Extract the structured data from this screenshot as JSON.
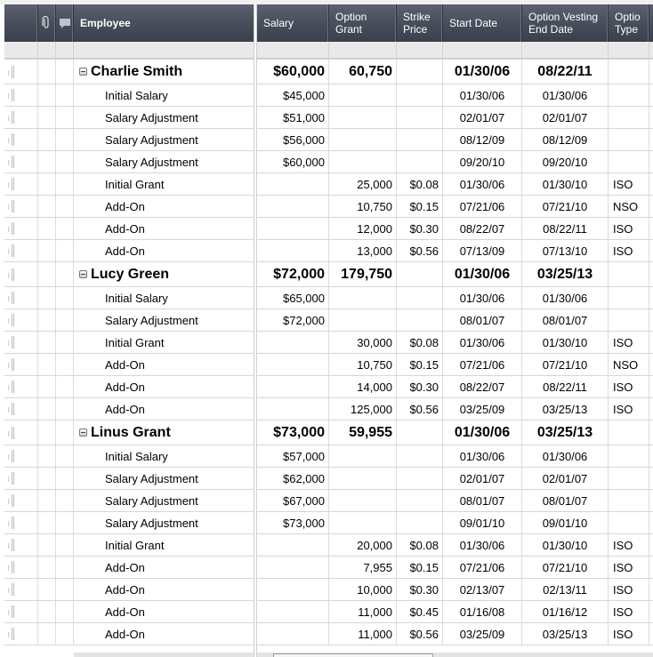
{
  "header": {
    "employee": "Employee",
    "salary": "Salary",
    "option_grant": [
      "Option",
      "Grant"
    ],
    "strike_price": [
      "Strike",
      "Price"
    ],
    "start_date": "Start Date",
    "vesting_end_date": [
      "Option Vesting",
      "End Date"
    ],
    "option_type": [
      "Optio",
      "Type"
    ]
  },
  "icons": {
    "attachment": "paperclip-icon",
    "comment": "comment-icon",
    "collapse": "collapse-minus-icon",
    "row_handle": "drag-handle-icon"
  },
  "colors": {
    "header_bg": "#4a505e",
    "header_text": "#ffffff",
    "filter_row_bg": "#e9e9e9",
    "grid_line": "#d6d6d6"
  },
  "rows": [
    {
      "level": "parent",
      "employee": "Charlie Smith",
      "salary": "$60,000",
      "grant": "60,750",
      "strike": "",
      "start": "01/30/06",
      "vest": "08/22/11",
      "type": ""
    },
    {
      "level": "child",
      "employee": "Initial Salary",
      "salary": "$45,000",
      "grant": "",
      "strike": "",
      "start": "01/30/06",
      "vest": "01/30/06",
      "type": ""
    },
    {
      "level": "child",
      "employee": "Salary Adjustment",
      "salary": "$51,000",
      "grant": "",
      "strike": "",
      "start": "02/01/07",
      "vest": "02/01/07",
      "type": ""
    },
    {
      "level": "child",
      "employee": "Salary Adjustment",
      "salary": "$56,000",
      "grant": "",
      "strike": "",
      "start": "08/12/09",
      "vest": "08/12/09",
      "type": ""
    },
    {
      "level": "child",
      "employee": "Salary Adjustment",
      "salary": "$60,000",
      "grant": "",
      "strike": "",
      "start": "09/20/10",
      "vest": "09/20/10",
      "type": ""
    },
    {
      "level": "child",
      "employee": "Initial Grant",
      "salary": "",
      "grant": "25,000",
      "strike": "$0.08",
      "start": "01/30/06",
      "vest": "01/30/10",
      "type": "ISO"
    },
    {
      "level": "child",
      "employee": "Add-On",
      "salary": "",
      "grant": "10,750",
      "strike": "$0.15",
      "start": "07/21/06",
      "vest": "07/21/10",
      "type": "NSO"
    },
    {
      "level": "child",
      "employee": "Add-On",
      "salary": "",
      "grant": "12,000",
      "strike": "$0.30",
      "start": "08/22/07",
      "vest": "08/22/11",
      "type": "ISO"
    },
    {
      "level": "child",
      "employee": "Add-On",
      "salary": "",
      "grant": "13,000",
      "strike": "$0.56",
      "start": "07/13/09",
      "vest": "07/13/10",
      "type": "ISO"
    },
    {
      "level": "parent",
      "employee": "Lucy Green",
      "salary": "$72,000",
      "grant": "179,750",
      "strike": "",
      "start": "01/30/06",
      "vest": "03/25/13",
      "type": ""
    },
    {
      "level": "child",
      "employee": "Initial Salary",
      "salary": "$65,000",
      "grant": "",
      "strike": "",
      "start": "01/30/06",
      "vest": "01/30/06",
      "type": ""
    },
    {
      "level": "child",
      "employee": "Salary Adjustment",
      "salary": "$72,000",
      "grant": "",
      "strike": "",
      "start": "08/01/07",
      "vest": "08/01/07",
      "type": ""
    },
    {
      "level": "child",
      "employee": "Initial Grant",
      "salary": "",
      "grant": "30,000",
      "strike": "$0.08",
      "start": "01/30/06",
      "vest": "01/30/10",
      "type": "ISO"
    },
    {
      "level": "child",
      "employee": "Add-On",
      "salary": "",
      "grant": "10,750",
      "strike": "$0.15",
      "start": "07/21/06",
      "vest": "07/21/10",
      "type": "NSO"
    },
    {
      "level": "child",
      "employee": "Add-On",
      "salary": "",
      "grant": "14,000",
      "strike": "$0.30",
      "start": "08/22/07",
      "vest": "08/22/11",
      "type": "ISO"
    },
    {
      "level": "child",
      "employee": "Add-On",
      "salary": "",
      "grant": "125,000",
      "strike": "$0.56",
      "start": "03/25/09",
      "vest": "03/25/13",
      "type": "ISO"
    },
    {
      "level": "parent",
      "employee": "Linus Grant",
      "salary": "$73,000",
      "grant": "59,955",
      "strike": "",
      "start": "01/30/06",
      "vest": "03/25/13",
      "type": ""
    },
    {
      "level": "child",
      "employee": "Initial Salary",
      "salary": "$57,000",
      "grant": "",
      "strike": "",
      "start": "01/30/06",
      "vest": "01/30/06",
      "type": ""
    },
    {
      "level": "child",
      "employee": "Salary Adjustment",
      "salary": "$62,000",
      "grant": "",
      "strike": "",
      "start": "02/01/07",
      "vest": "02/01/07",
      "type": ""
    },
    {
      "level": "child",
      "employee": "Salary Adjustment",
      "salary": "$67,000",
      "grant": "",
      "strike": "",
      "start": "08/01/07",
      "vest": "08/01/07",
      "type": ""
    },
    {
      "level": "child",
      "employee": "Salary Adjustment",
      "salary": "$73,000",
      "grant": "",
      "strike": "",
      "start": "09/01/10",
      "vest": "09/01/10",
      "type": ""
    },
    {
      "level": "child",
      "employee": "Initial Grant",
      "salary": "",
      "grant": "20,000",
      "strike": "$0.08",
      "start": "01/30/06",
      "vest": "01/30/10",
      "type": "ISO"
    },
    {
      "level": "child",
      "employee": "Add-On",
      "salary": "",
      "grant": "7,955",
      "strike": "$0.15",
      "start": "07/21/06",
      "vest": "07/21/10",
      "type": "ISO"
    },
    {
      "level": "child",
      "employee": "Add-On",
      "salary": "",
      "grant": "10,000",
      "strike": "$0.30",
      "start": "02/13/07",
      "vest": "02/13/11",
      "type": "ISO"
    },
    {
      "level": "child",
      "employee": "Add-On",
      "salary": "",
      "grant": "11,000",
      "strike": "$0.45",
      "start": "01/16/08",
      "vest": "01/16/12",
      "type": "ISO"
    },
    {
      "level": "child",
      "employee": "Add-On",
      "salary": "",
      "grant": "11,000",
      "strike": "$0.56",
      "start": "03/25/09",
      "vest": "03/25/13",
      "type": "ISO"
    }
  ]
}
